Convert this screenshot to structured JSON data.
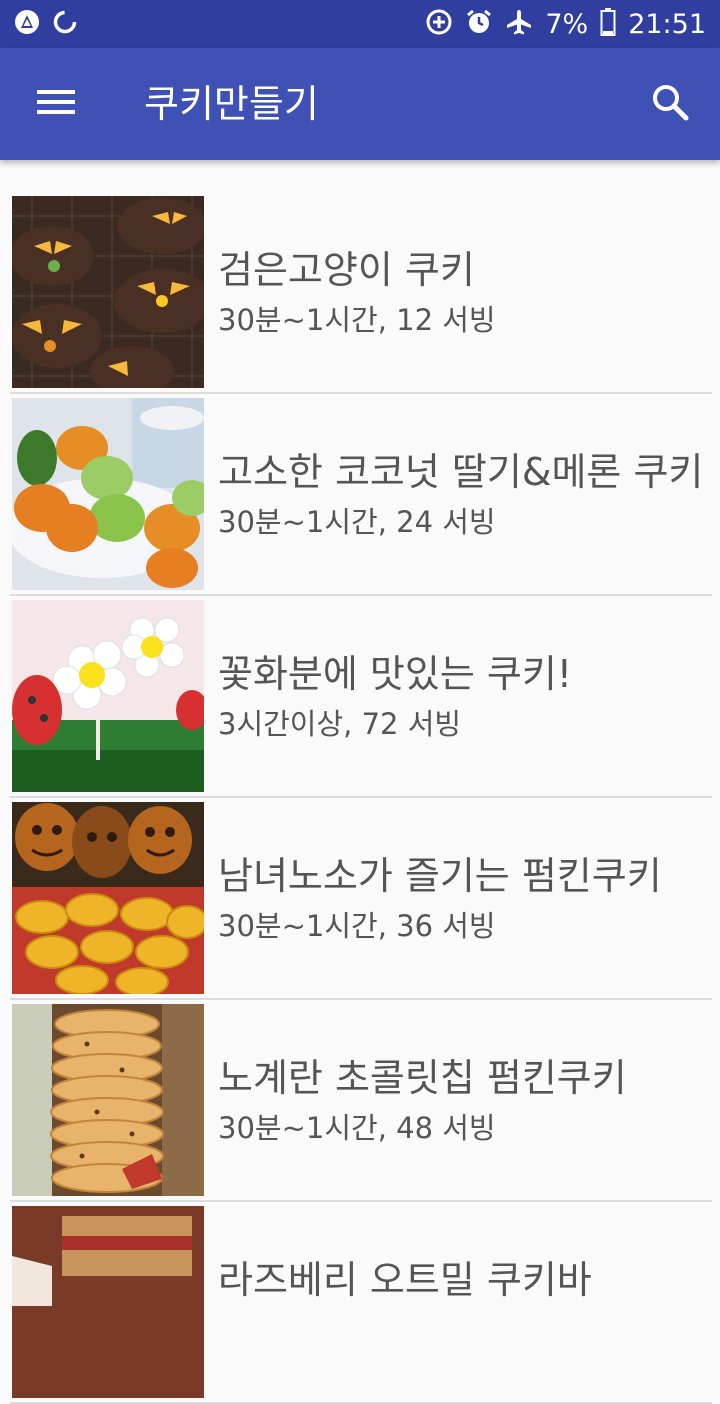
{
  "status_bar": {
    "battery_percent": "7%",
    "time": "21:51"
  },
  "app_bar": {
    "title": "쿠키만들기",
    "menu_icon": "menu-icon",
    "search_icon": "search-icon"
  },
  "recipes": [
    {
      "title": "검은고양이 쿠키",
      "subtitle": "30분~1시간, 12 서빙"
    },
    {
      "title": "고소한 코코넛 딸기&메론 쿠키",
      "subtitle": "30분~1시간, 24 서빙"
    },
    {
      "title": "꽃화분에 맛있는 쿠키!",
      "subtitle": "3시간이상, 72 서빙"
    },
    {
      "title": "남녀노소가 즐기는 펌킨쿠키",
      "subtitle": "30분~1시간, 36 서빙"
    },
    {
      "title": "노계란 초콜릿칩 펌킨쿠키",
      "subtitle": "30분~1시간, 48 서빙"
    },
    {
      "title": "라즈베리 오트밀 쿠키바",
      "subtitle": ""
    }
  ],
  "colors": {
    "status_bar": "#303f9f",
    "app_bar": "#3f51b5",
    "background": "#fafafa",
    "text": "#555555"
  }
}
